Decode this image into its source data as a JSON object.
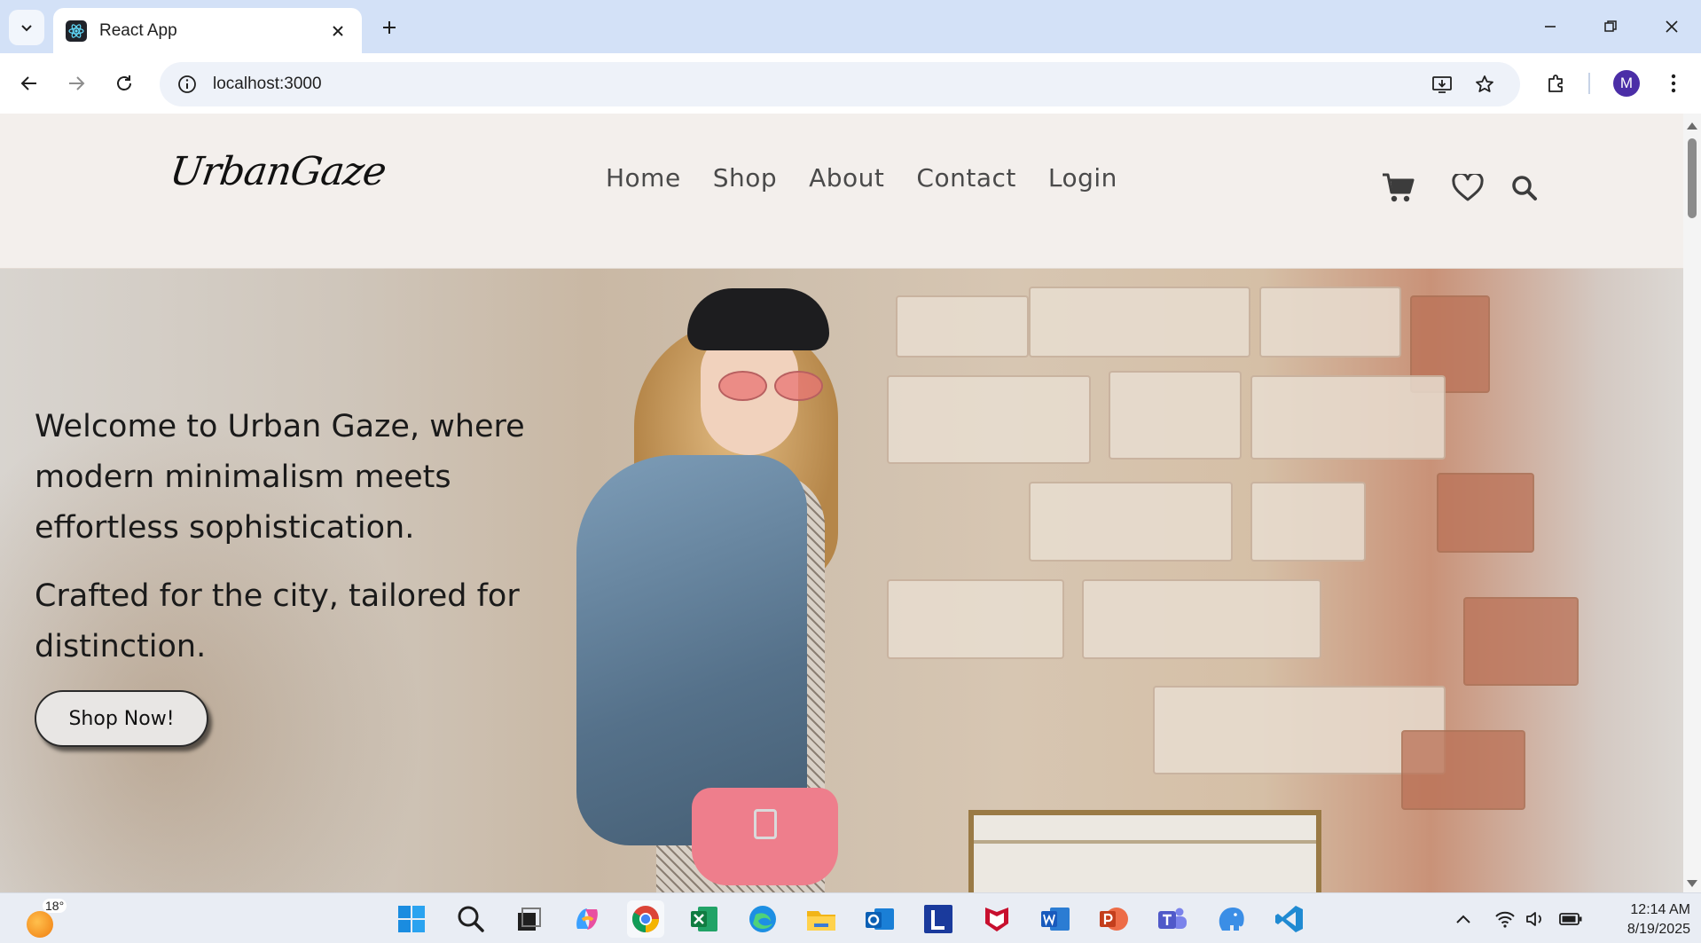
{
  "browser": {
    "tab_title": "React App",
    "url": "localhost:3000",
    "profile_initial": "M"
  },
  "site": {
    "logo": "UrbanGaze",
    "nav": [
      {
        "label": "Home"
      },
      {
        "label": "Shop"
      },
      {
        "label": "About"
      },
      {
        "label": "Contact"
      },
      {
        "label": "Login"
      }
    ],
    "icons": [
      "cart-icon",
      "heart-icon",
      "search-icon"
    ]
  },
  "hero": {
    "paragraph1": "Welcome to Urban Gaze, where modern minimalism meets effortless sophistication.",
    "paragraph2": "Crafted for the city, tailored for distinction.",
    "cta": "Shop Now!"
  },
  "taskbar": {
    "temperature": "18°",
    "time": "12:14 AM",
    "date": "8/19/2025",
    "apps": [
      "windows-start-icon",
      "search-icon",
      "task-view-icon",
      "copilot-icon",
      "chrome-icon",
      "excel-icon",
      "edge-icon",
      "file-explorer-icon",
      "outlook-icon",
      "l-app-icon",
      "mcafee-icon",
      "word-icon",
      "powerpoint-icon",
      "teams-icon",
      "elephant-app-icon",
      "vscode-icon"
    ]
  },
  "colors": {
    "tabstrip": "#d3e1f7",
    "header_bg": "#f3efec",
    "nav_text": "#4a4a4a",
    "profile": "#4b2ea7"
  }
}
